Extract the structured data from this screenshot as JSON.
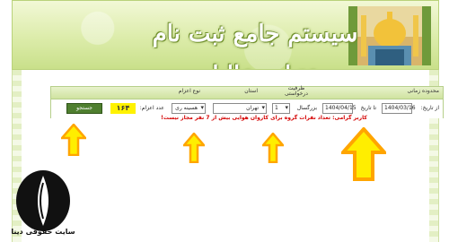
{
  "banner": {
    "title": "سیستم جامع ثبت نام عتبات عالیات"
  },
  "search_panel": {
    "headers": {
      "date_range": "محدوده زمانی",
      "capacity": "ظرفیت درخواستی",
      "province": "استان",
      "dispatch_type": "نوع اعزام"
    },
    "from_label": "از تاریخ:",
    "from_date": "1404/03/16",
    "to_label": "تا تاریخ",
    "to_date": "1404/04/15",
    "adult_label": "بزرگسال",
    "adult_count": "1",
    "province_value": "تهران",
    "dispatch_value": "هسینه ری",
    "result_count_label": "عدد اعزام:",
    "result_count_value": "164",
    "badge_text": "۱۶۴",
    "search_button": "جستجو"
  },
  "warning_text": "کاربر گرامی: تعداد نفرات گروه برای کاروان هوایی بیش از 7 نفر مجاز نیست!",
  "logo": {
    "caption": "سایت حقوقی دینا"
  },
  "colors": {
    "banner_green": "#dcecaa",
    "button_green": "#4f7f2f",
    "warning_red": "#d40000",
    "badge_yellow": "#fff200",
    "arrow_orange": "#ffa500",
    "arrow_yellow": "#ffee00"
  }
}
